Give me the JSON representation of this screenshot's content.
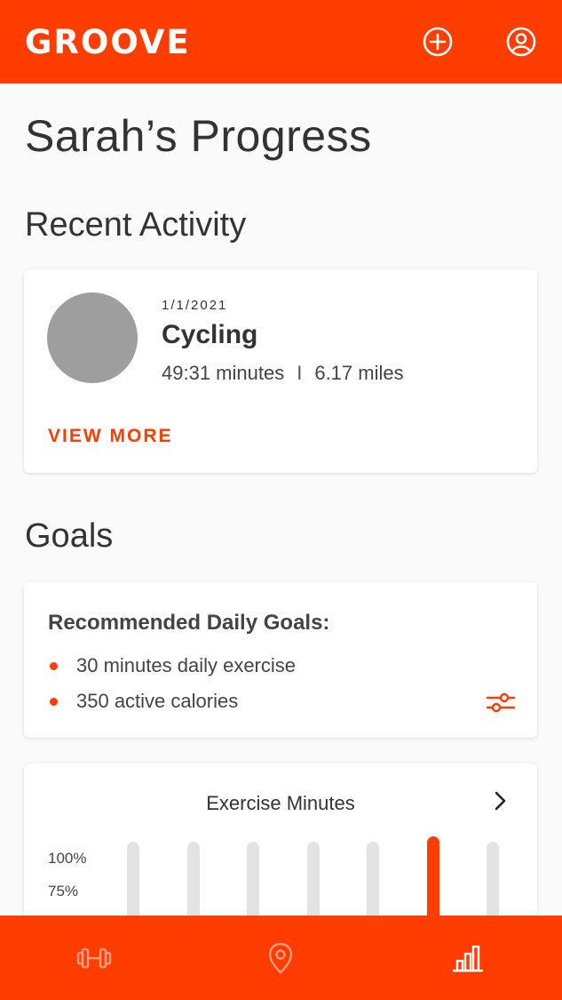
{
  "app": {
    "brand": "GROOVE"
  },
  "header": {
    "icons": [
      "add-circle-icon",
      "account-icon"
    ]
  },
  "page": {
    "title": "Sarah’s Progress"
  },
  "recent_activity": {
    "section_title": "Recent Activity",
    "date": "1/1/2021",
    "activity": "Cycling",
    "duration": "49:31 minutes",
    "separator": "I",
    "distance": "6.17 miles",
    "view_more_label": "VIEW MORE"
  },
  "goals": {
    "section_title": "Goals",
    "heading": "Recommended Daily Goals:",
    "items": [
      "30 minutes daily exercise",
      "350 active calories"
    ],
    "icon": "sliders-icon"
  },
  "exercise_chart": {
    "title": "Exercise Minutes",
    "icon": "chevron-right-icon",
    "y_ticks": [
      "100%",
      "75%"
    ],
    "chart_data": {
      "type": "bar",
      "title": "Exercise Minutes",
      "bars": 7,
      "highlight_index": 5,
      "highlight_color": "#ff3d00",
      "track_color": "#e3e3e3",
      "y_ticks": [
        "100%",
        "75%"
      ],
      "ylim_visible": [
        "75%",
        "100%"
      ]
    }
  },
  "bottom_nav": {
    "items": [
      "dumbbell-icon",
      "location-pin-icon",
      "bar-chart-icon"
    ]
  },
  "colors": {
    "accent": "#ff3d00",
    "background": "#fafafa",
    "avatar": "#9e9e9e"
  }
}
